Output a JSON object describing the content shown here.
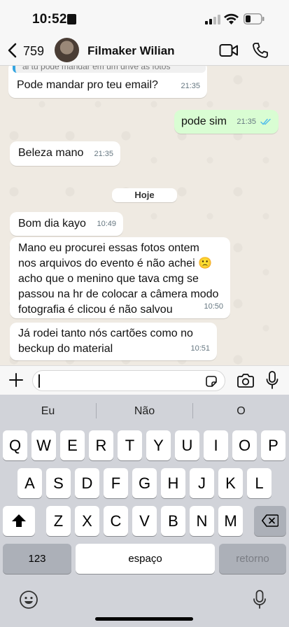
{
  "status_bar": {
    "time": "10:52"
  },
  "header": {
    "unread_count": "759",
    "contact_name": "Filmaker Wilian"
  },
  "messages": [
    {
      "quoted": "ai tu pode mandar em um drive as fotos",
      "text": "Pode mandar pro teu email?",
      "time": "21:35",
      "direction": "in"
    },
    {
      "text": "pode sim",
      "time": "21:35",
      "direction": "out",
      "read": true
    },
    {
      "text": "Beleza mano",
      "time": "21:35",
      "direction": "in"
    },
    {
      "text": "Bom dia kayo",
      "time": "10:49",
      "direction": "in"
    },
    {
      "lines": [
        "Mano eu procurei essas fotos ontem",
        "nos arquivos do evento é não achei 🙁",
        "acho que o menino que tava cmg se",
        "passou na hr de colocar a câmera modo",
        "fotografia é clicou é não salvou"
      ],
      "time": "10:50",
      "direction": "in"
    },
    {
      "lines": [
        "Já rodei tanto nós cartões como no",
        "beckup do material"
      ],
      "time": "10:51",
      "direction": "in"
    }
  ],
  "date_divider": "Hoje",
  "composer": {
    "value": ""
  },
  "keyboard": {
    "suggestions": [
      "Eu",
      "Não",
      "O"
    ],
    "row1": [
      "Q",
      "W",
      "E",
      "R",
      "T",
      "Y",
      "U",
      "I",
      "O",
      "P"
    ],
    "row2": [
      "A",
      "S",
      "D",
      "F",
      "G",
      "H",
      "J",
      "K",
      "L"
    ],
    "row3": [
      "Z",
      "X",
      "C",
      "V",
      "B",
      "N",
      "M"
    ],
    "numbers_key": "123",
    "space_key": "espaço",
    "return_key": "retorno"
  },
  "colors": {
    "outgoing_bubble": "#d9fdd3",
    "incoming_bubble": "#ffffff",
    "read_ticks": "#53bdeb",
    "chat_bg": "#efeae2"
  }
}
